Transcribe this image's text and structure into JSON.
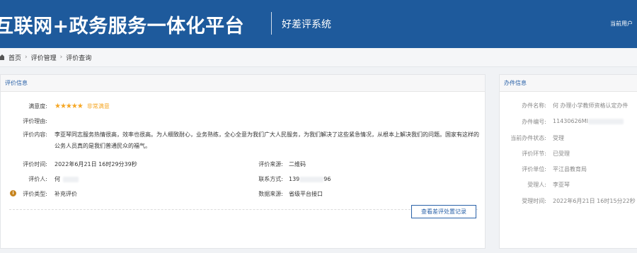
{
  "header": {
    "title": "互联网+政务服务一体化平台",
    "subtitle": "好差评系统",
    "user": "当前用户"
  },
  "breadcrumb": {
    "items": [
      "首页",
      "评价管理",
      "评价查询"
    ]
  },
  "left_panel": {
    "title": "评价信息",
    "satisfaction_label": "满意度:",
    "satisfaction_rating": 5,
    "satisfaction_text": "非常满意",
    "reason_label": "评价理由:",
    "content_label": "评价内容:",
    "content_text": "李亚琴同志服务热情很高，效率也很高。为人细致耐心，业务熟练，全心全意为我们广大人民服务，为我们解决了这些紧急情况，从根本上解决我们的问题。国家有这样的公务人员真的是我们普通民众的福气。",
    "time_label": "评价时间:",
    "time_value": "2022年6月21日 16时29分39秒",
    "source_label": "评价来源:",
    "source_value": "二维码",
    "evaluator_label": "评价人:",
    "evaluator_value": "何",
    "contact_label": "联系方式:",
    "contact_prefix": "139",
    "contact_suffix": "96",
    "type_label": "评价类型:",
    "type_value": "补充评价",
    "data_source_label": "数据来源:",
    "data_source_value": "省级平台接口",
    "button_label": "查看差评处置记录"
  },
  "right_panel": {
    "title": "办件信息",
    "rows": [
      {
        "label": "办件名称:",
        "value": "何   办理小学教师资格认定办件"
      },
      {
        "label": "办件编号:",
        "value": "11430626MI"
      },
      {
        "label": "当前办件状态:",
        "value": "受理"
      },
      {
        "label": "评价环节:",
        "value": "已受理"
      },
      {
        "label": "评价单位:",
        "value": "平江县教育局"
      },
      {
        "label": "受理人:",
        "value": "李亚琴"
      },
      {
        "label": "受理时间:",
        "value": "2022年6月21日 16时15分22秒"
      }
    ]
  },
  "colors": {
    "header_bg": "#1e5a9c",
    "accent": "#2a62a8",
    "star": "#f5a623",
    "info_icon": "#c6841e"
  },
  "icons": {
    "home": "home-icon",
    "info": "info-icon",
    "star": "star-icon"
  }
}
